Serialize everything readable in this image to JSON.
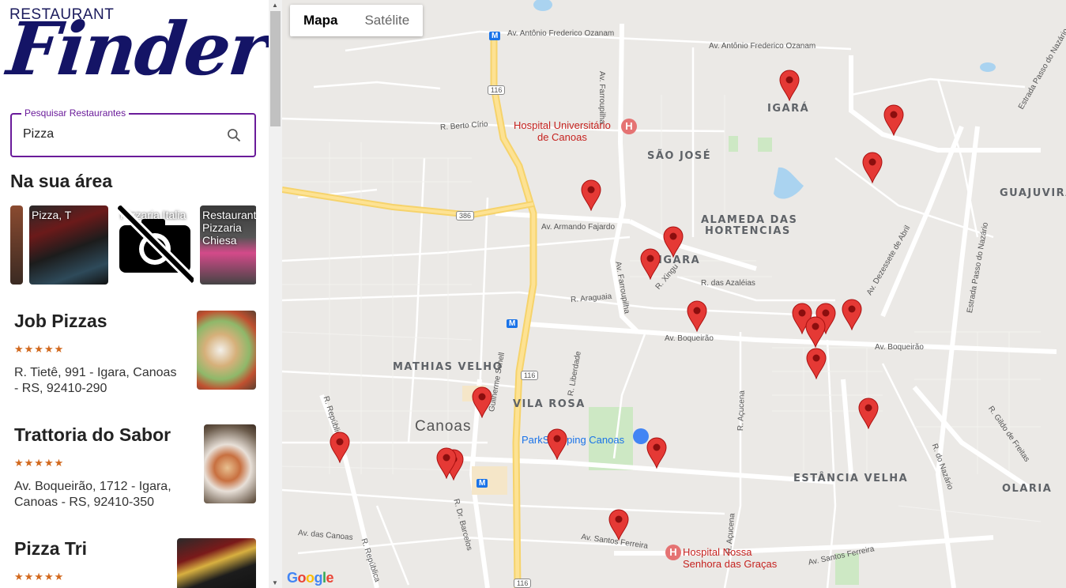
{
  "brand": {
    "small": "RESTAURANT",
    "big": "Finder"
  },
  "search": {
    "label": "Pesquisar Restaurantes",
    "value": "Pizza"
  },
  "section_title": "Na sua área",
  "carousel": [
    {
      "label": "Pizza, T"
    },
    {
      "label": "Pizzaria Italia"
    },
    {
      "label": "Restaurante e Pizzaria Chiesa"
    }
  ],
  "results": [
    {
      "name": "Job Pizzas",
      "stars": "★★★★★",
      "address": "R. Tietê, 991 - Igara, Canoas - RS, 92410-290"
    },
    {
      "name": "Trattoria do Sabor",
      "stars": "★★★★★",
      "address": "Av. Boqueirão, 1712 - Igara, Canoas - RS, 92410-350"
    },
    {
      "name": "Pizza Tri",
      "stars": "★★★★★",
      "address": ""
    }
  ],
  "map": {
    "type_buttons": [
      "Mapa",
      "Satélite"
    ],
    "neighborhoods": [
      "IGARÁ",
      "SÃO JOSÉ",
      "GUAJUVIRA",
      "ALAMEDA DAS",
      "HORTENCIAS",
      "IGARA",
      "MATHIAS VELHO",
      "VILA ROSA",
      "ESTÂNCIA VELHA",
      "OLARIA"
    ],
    "city": "Canoas",
    "streets": [
      "Av. Antônio Frederico Ozanam",
      "Av. Antônio Frederico Ozanam",
      "R. Berto Círio",
      "Av. Armando Fajardo",
      "R. das Azaléias",
      "R. Araguaia",
      "R. Xingu",
      "Av. Boqueirão",
      "Av. Boqueirão",
      "Av. Farroupilha",
      "Av. Farroupilha",
      "Av. Dezessete de Abril",
      "Estrada Passo do Nazário",
      "Estrada Passo do Nazário",
      "R. Liberdade",
      "Guilherme Schell",
      "R. República",
      "R. República",
      "Av. das Canoas",
      "R. Dr. Barcelos",
      "Av. Santos Ferreira",
      "Av. Santos Ferreira",
      "R. Açucena",
      "R. Açucena",
      "R. Gildo de Freitas",
      "R. do Nazário"
    ],
    "road_badges": [
      "116",
      "386",
      "116",
      "116"
    ],
    "pois": [
      {
        "line1": "Hospital Universitário",
        "line2": "de Canoas"
      },
      {
        "line1": "ParkShopping Canoas",
        "line2": ""
      },
      {
        "line1": "Hospital Nossa",
        "line2": "Senhora das Graças"
      }
    ],
    "attribution": "Google",
    "metro": "M"
  },
  "colors": {
    "accent": "#6a1b9a",
    "brand": "#141466",
    "marker": "#e53935",
    "star": "#d2691e"
  }
}
